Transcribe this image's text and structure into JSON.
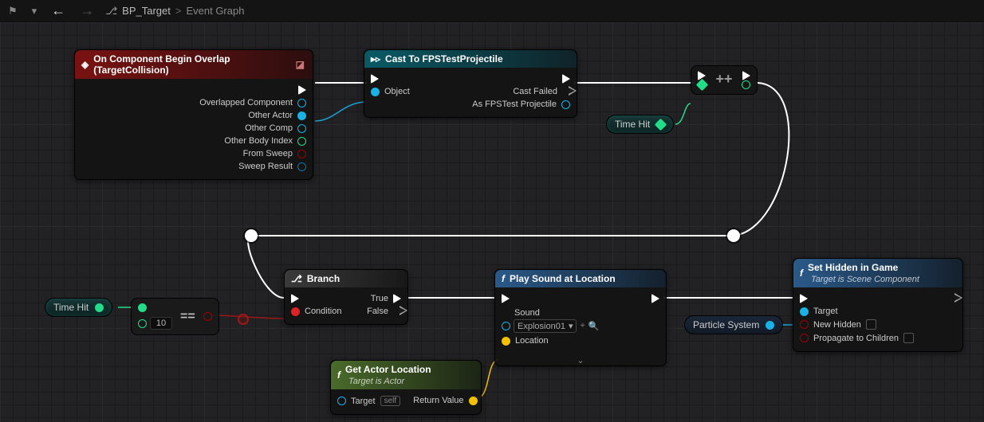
{
  "toolbar": {
    "bookmark": "⚑",
    "dropdown": "▾",
    "back": "←",
    "forward": "→",
    "icon": "⎌"
  },
  "breadcrumb": {
    "blueprint": "BP_Target",
    "separator": ">",
    "graph": "Event Graph"
  },
  "nodes": {
    "overlap": {
      "title": "On Component Begin Overlap (TargetCollision)",
      "pins": {
        "overlapped": "Overlapped Component",
        "other_actor": "Other Actor",
        "other_comp": "Other Comp",
        "body_index": "Other Body Index",
        "from_sweep": "From Sweep",
        "sweep_result": "Sweep Result"
      }
    },
    "cast": {
      "title": "Cast To FPSTestProjectile",
      "pins": {
        "object": "Object",
        "cast_failed": "Cast Failed",
        "as": "As FPSTest Projectile"
      }
    },
    "inc": {
      "symbol": "++"
    },
    "time_hit_var": {
      "label": "Time Hit"
    },
    "time_hit_get": {
      "label": "Time Hit"
    },
    "equals": {
      "symbol": "==",
      "literal": "10"
    },
    "branch": {
      "title": "Branch",
      "pins": {
        "condition": "Condition",
        "true": "True",
        "false": "False"
      }
    },
    "get_loc": {
      "title": "Get Actor Location",
      "subtitle": "Target is Actor",
      "pins": {
        "target": "Target",
        "self": "self",
        "return": "Return Value"
      }
    },
    "play_sound": {
      "title": "Play Sound at Location",
      "pins": {
        "sound": "Sound",
        "sound_val": "Explosion01",
        "location": "Location"
      }
    },
    "particle_pill": {
      "label": "Particle System"
    },
    "set_hidden": {
      "title": "Set Hidden in Game",
      "subtitle": "Target is Scene Component",
      "pins": {
        "target": "Target",
        "new_hidden": "New Hidden",
        "propagate": "Propagate to Children"
      }
    }
  }
}
